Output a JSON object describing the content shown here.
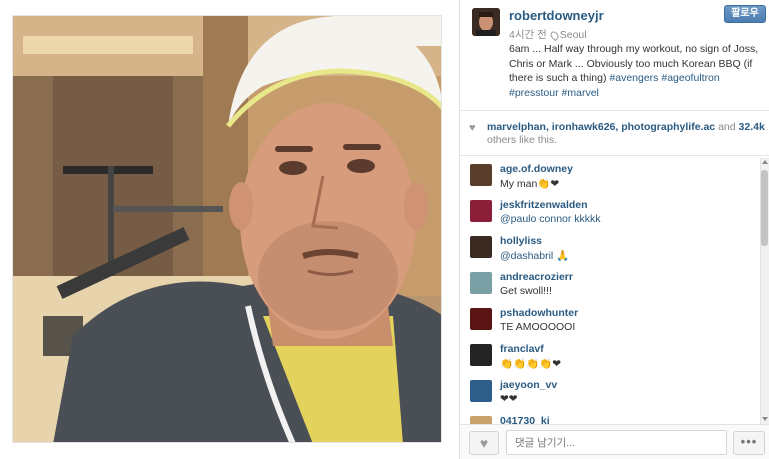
{
  "post": {
    "username": "robertdowneyjr",
    "time_ago": "4시간 전",
    "location": "Seoul",
    "follow_label": "팔로우",
    "caption_text": "6am ... Half way through my workout, no sign of Joss, Chris or Mark ... Obviously too much Korean BBQ (if there is such a thing) ",
    "hashtags": [
      "#avengers",
      "#ageofultron",
      "#presstour",
      "#marvel"
    ]
  },
  "likes": {
    "users": "marvelphan, ironhawk626, photographylife.ac",
    "joiner": " and ",
    "count": "32.4k",
    "suffix": " others like this."
  },
  "comments": [
    {
      "user": "age.of.downey",
      "mention": "",
      "text": "My man👏❤",
      "avatar_color": "#5a3d2b"
    },
    {
      "user": "jeskfritzenwalden",
      "mention": "",
      "text": "@paulo  connor kkkkk",
      "avatar_color": "#8b1f3a"
    },
    {
      "user": "hollyliss",
      "mention": "@dashabril",
      "text": " 🙏",
      "avatar_color": "#3a2a22"
    },
    {
      "user": "andreacrozierr",
      "mention": "",
      "text": "Get swoll!!!",
      "avatar_color": "#7aa0a6"
    },
    {
      "user": "pshadowhunter",
      "mention": "",
      "text": "TE AMOOOOOI",
      "avatar_color": "#5b1414"
    },
    {
      "user": "franclavf",
      "mention": "",
      "text": "👏👏👏👏❤",
      "avatar_color": "#242424"
    },
    {
      "user": "jaeyoon_vv",
      "mention": "",
      "text": "❤❤",
      "avatar_color": "#2e5f8a"
    },
    {
      "user": "041730_ki",
      "mention": "",
      "text": "",
      "avatar_color": "#c9a26b"
    }
  ],
  "footer": {
    "comment_placeholder": "댓글 남기기...",
    "more_label": "•••"
  },
  "colors": {
    "link_blue": "#2a5b83",
    "follow_button": "#4c7eb1"
  },
  "icons": [
    "heart-icon",
    "location-pin-icon",
    "more-dots-icon"
  ]
}
